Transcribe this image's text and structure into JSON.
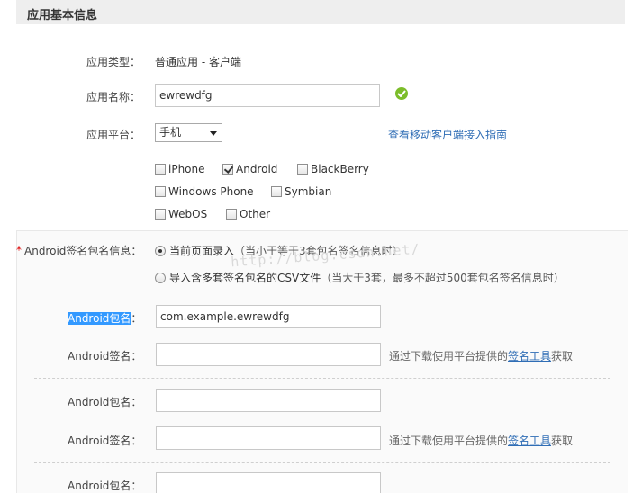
{
  "header": {
    "title": "应用基本信息"
  },
  "app_type": {
    "label": "应用类型：",
    "value": "普通应用  -  客户端"
  },
  "app_name": {
    "label": "应用名称：",
    "value": "ewrewdfg"
  },
  "platform": {
    "label": "应用平台：",
    "selected": "手机",
    "guide_link": "查看移动客户端接入指南",
    "options": [
      {
        "label": "iPhone",
        "checked": false
      },
      {
        "label": "Android",
        "checked": true
      },
      {
        "label": "BlackBerry",
        "checked": false
      },
      {
        "label": "Windows Phone",
        "checked": false
      },
      {
        "label": "Symbian",
        "checked": false
      },
      {
        "label": "WebOS",
        "checked": false
      },
      {
        "label": "Other",
        "checked": false
      }
    ]
  },
  "android_sign": {
    "required_mark": "*",
    "label": "Android签名包名信息：",
    "radio_page": {
      "main": "当前页面录入",
      "note": "（当小于等于3套包名签名信息时）"
    },
    "radio_csv": {
      "main": "导入含多套签名包名的CSV文件",
      "note": "（当大于3套，最多不超过500套包名签名信息时）"
    },
    "package_label": "Android包名",
    "package_colon": "：",
    "package_label_full": "Android包名：",
    "signature_label": "Android签名：",
    "package_value": "com.example.ewrewdfg",
    "hint_before": "通过下载使用平台提供的",
    "hint_link": "签名工具",
    "hint_after": "获取"
  },
  "watermark": "http://blog.csdn.net/"
}
